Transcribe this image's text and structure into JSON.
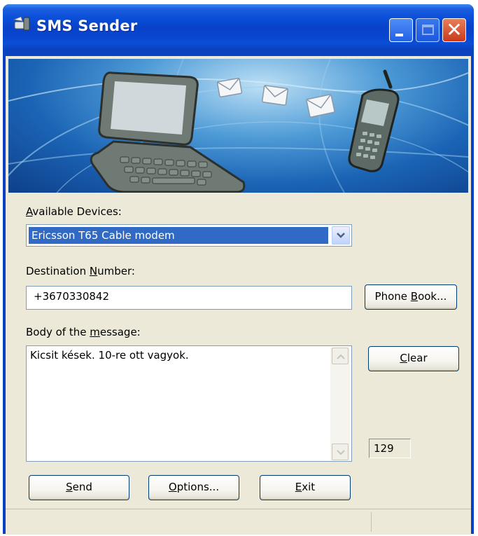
{
  "window": {
    "title": "SMS Sender",
    "controls": [
      "minimize-icon",
      "maximize-icon",
      "close-icon"
    ]
  },
  "banner": {
    "icons": [
      "laptop-illustration",
      "envelope-icon",
      "envelope-icon",
      "envelope-icon",
      "mobile-phone-illustration"
    ]
  },
  "devices": {
    "label_accel": "A",
    "label_rest": "vailable Devices:",
    "selected": "Ericsson T65 Cable modem"
  },
  "destination": {
    "label_pre": "Destination ",
    "label_accel": "N",
    "label_post": "umber:",
    "value": "+3670330842",
    "phonebook_pre": "Phone ",
    "phonebook_accel": "B",
    "phonebook_post": "ook..."
  },
  "message": {
    "label_pre": "Body of the ",
    "label_accel": "m",
    "label_post": "essage:",
    "body": "Kicsit kések. 10-re ott vagyok.",
    "clear_accel": "C",
    "clear_rest": "lear",
    "remaining_chars": "129"
  },
  "actions": {
    "send_accel": "S",
    "send_rest": "end",
    "options_accel": "O",
    "options_rest": "ptions...",
    "exit_accel": "E",
    "exit_rest": "xit"
  },
  "colors": {
    "titlebar": "#0a4ed8",
    "client_bg": "#ece9d8",
    "selection": "#316ac5",
    "close_button": "#c9391b"
  }
}
